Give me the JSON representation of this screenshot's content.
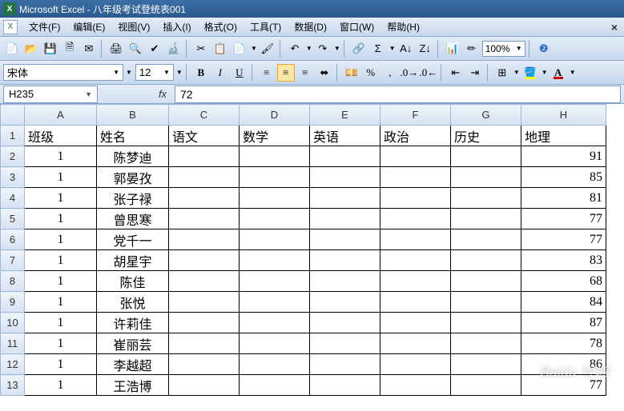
{
  "app": {
    "title": "Microsoft Excel - 八年级考试登统表001"
  },
  "menu": {
    "file": "文件(F)",
    "edit": "编辑(E)",
    "view": "视图(V)",
    "insert": "插入(I)",
    "format": "格式(O)",
    "tools": "工具(T)",
    "data": "数据(D)",
    "window": "窗口(W)",
    "help": "帮助(H)"
  },
  "toolbar": {
    "zoom": "100%"
  },
  "format": {
    "fontname": "宋体",
    "fontsize": "12"
  },
  "formula": {
    "namebox": "H235",
    "fx": "fx",
    "value": "72"
  },
  "columns": [
    "A",
    "B",
    "C",
    "D",
    "E",
    "F",
    "G",
    "H"
  ],
  "rownums": [
    "1",
    "2",
    "3",
    "4",
    "5",
    "6",
    "7",
    "8",
    "9",
    "10",
    "11",
    "12",
    "13"
  ],
  "headers": {
    "A": "班级",
    "B": "姓名",
    "C": "语文",
    "D": "数学",
    "E": "英语",
    "F": "政治",
    "G": "历史",
    "H": "地理"
  },
  "rows": [
    {
      "class": "1",
      "name": "陈梦迪",
      "h": "91"
    },
    {
      "class": "1",
      "name": "郭晏孜",
      "h": "85"
    },
    {
      "class": "1",
      "name": "张子禄",
      "h": "81"
    },
    {
      "class": "1",
      "name": "曾思寒",
      "h": "77"
    },
    {
      "class": "1",
      "name": "党千一",
      "h": "77"
    },
    {
      "class": "1",
      "name": "胡星宇",
      "h": "83"
    },
    {
      "class": "1",
      "name": "陈佳",
      "h": "68"
    },
    {
      "class": "1",
      "name": "张悦",
      "h": "84"
    },
    {
      "class": "1",
      "name": "许莉佳",
      "h": "87"
    },
    {
      "class": "1",
      "name": "崔丽芸",
      "h": "78"
    },
    {
      "class": "1",
      "name": "李越超",
      "h": "86"
    },
    {
      "class": "1",
      "name": "王浩博",
      "h": "77"
    }
  ],
  "watermark": "Baidu 经验"
}
